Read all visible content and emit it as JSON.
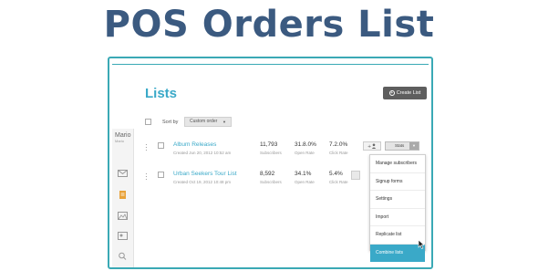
{
  "page_title": "POS Orders List",
  "app": {
    "heading": "Lists",
    "create_button": "Create List",
    "sidebar": {
      "user_name": "Mario",
      "user_sub": "Mario",
      "icons": [
        "envelope-icon",
        "document-icon",
        "image-icon",
        "picture-icon",
        "search-icon",
        "chevron-down-icon"
      ]
    },
    "toolbar": {
      "sort_label": "Sort by",
      "sort_value": "Custom order"
    },
    "lists": [
      {
        "name": "Album Releases",
        "created": "Created Jun 20, 2012 10:52 am",
        "subscribers": "11,793",
        "subscribers_label": "Subscribers",
        "open_rate": "31.8.0%",
        "open_rate_label": "Open Rate",
        "click_rate": "7.2.0%",
        "click_rate_label": "Click Rate",
        "stats_button": "Stats"
      },
      {
        "name": "Urban Seekers Tour List",
        "created": "Created Oct 19, 2012 10:48 pm",
        "subscribers": "8,592",
        "subscribers_label": "Subscribers",
        "open_rate": "34.1%",
        "open_rate_label": "Open Rate",
        "click_rate": "5.4%",
        "click_rate_label": "Click Rate"
      }
    ],
    "dropdown_menu": [
      "Manage subscribers",
      "Signup forms",
      "Settings",
      "Import",
      "Replicate list",
      "Combine lists"
    ],
    "active_menu_item": "Combine lists",
    "accent_color": "#3aa9c8",
    "title_color": "#3b5a80"
  }
}
